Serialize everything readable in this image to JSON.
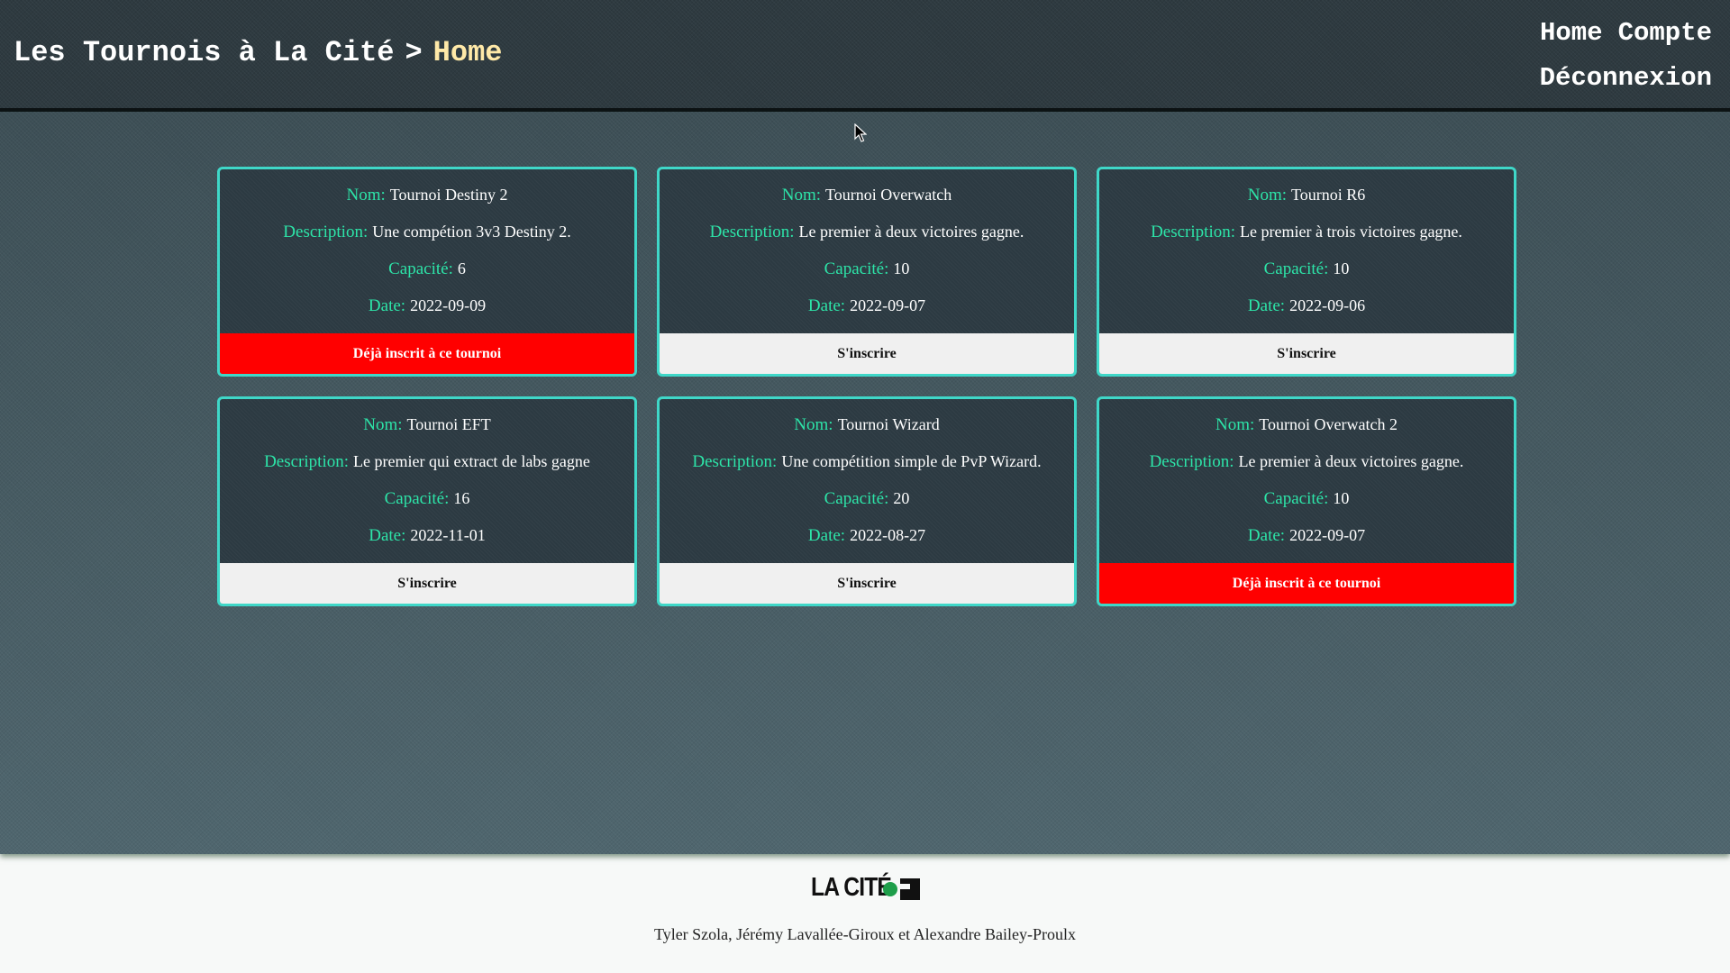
{
  "header": {
    "title": "Les Tournois à La Cité",
    "separator": ">",
    "current_page": "Home",
    "nav": [
      "Home",
      "Compte",
      "Déconnexion"
    ]
  },
  "labels": {
    "name": "Nom:",
    "description": "Description:",
    "capacity": "Capacité:",
    "date": "Date:"
  },
  "tournaments": [
    {
      "name": "Tournoi Destiny 2",
      "description": "Une compétion 3v3 Destiny 2.",
      "capacity": "6",
      "date": "2022-09-09",
      "button": "Déjà inscrit à ce tournoi",
      "status": "registered"
    },
    {
      "name": "Tournoi Overwatch",
      "description": "Le premier à deux victoires gagne.",
      "capacity": "10",
      "date": "2022-09-07",
      "button": "S'inscrire",
      "status": "open"
    },
    {
      "name": "Tournoi R6",
      "description": "Le premier à trois victoires gagne.",
      "capacity": "10",
      "date": "2022-09-06",
      "button": "S'inscrire",
      "status": "open"
    },
    {
      "name": "Tournoi EFT",
      "description": "Le premier qui extract de labs gagne",
      "capacity": "16",
      "date": "2022-11-01",
      "button": "S'inscrire",
      "status": "open"
    },
    {
      "name": "Tournoi Wizard",
      "description": "Une compétition simple de PvP Wizard.",
      "capacity": "20",
      "date": "2022-08-27",
      "button": "S'inscrire",
      "status": "open"
    },
    {
      "name": "Tournoi Overwatch 2",
      "description": "Le premier à deux victoires gagne.",
      "capacity": "10",
      "date": "2022-09-07",
      "button": "Déjà inscrit à ce tournoi",
      "status": "registered"
    }
  ],
  "footer": {
    "logo_text": "LA CITÉ",
    "credits": "Tyler Szola, Jérémy Lavallée-Giroux et Alexandre Bailey-Proulx"
  },
  "colors": {
    "accent_border": "#3fd7c8",
    "label_green": "#2de4a8",
    "registered_red": "#ff0000",
    "logo_green": "#1e9e4a"
  }
}
